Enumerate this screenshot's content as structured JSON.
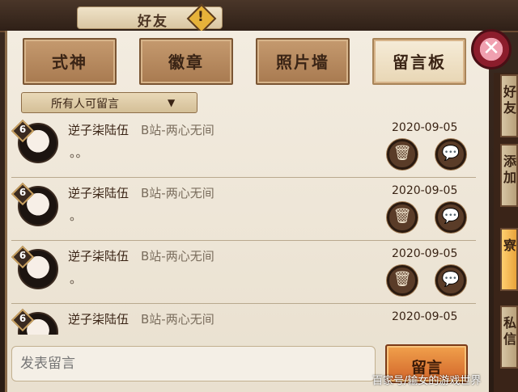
{
  "header": {
    "title": "好友",
    "alert_icon": "exclamation-icon",
    "alert_glyph": "!"
  },
  "tabs": [
    {
      "label": "式神",
      "active": false
    },
    {
      "label": "徽章",
      "active": false
    },
    {
      "label": "照片墙",
      "active": false
    },
    {
      "label": "留言板",
      "active": true
    }
  ],
  "filter": {
    "label": "所有人可留言",
    "caret": "▼"
  },
  "messages": [
    {
      "level": "6",
      "name": "逆子柒陆伍",
      "server": "B站-两心无间",
      "date": "2020-09-05",
      "text": "。。"
    },
    {
      "level": "6",
      "name": "逆子柒陆伍",
      "server": "B站-两心无间",
      "date": "2020-09-05",
      "text": "。"
    },
    {
      "level": "6",
      "name": "逆子柒陆伍",
      "server": "B站-两心无间",
      "date": "2020-09-05",
      "text": "。"
    },
    {
      "level": "6",
      "name": "逆子柒陆伍",
      "server": "B站-两心无间",
      "date": "2020-09-05",
      "text": ""
    }
  ],
  "actions": {
    "delete_glyph": "🗑",
    "reply_glyph": "💬"
  },
  "compose": {
    "placeholder": "发表留言",
    "send_label": "留言"
  },
  "close_glyph": "✕",
  "side_tabs": [
    {
      "label": "好友",
      "active": false
    },
    {
      "label": "添加",
      "active": false
    },
    {
      "label": "寮",
      "active": true
    },
    {
      "label": "私信",
      "active": false
    }
  ],
  "watermark": "百家号/输女的游戏世界"
}
